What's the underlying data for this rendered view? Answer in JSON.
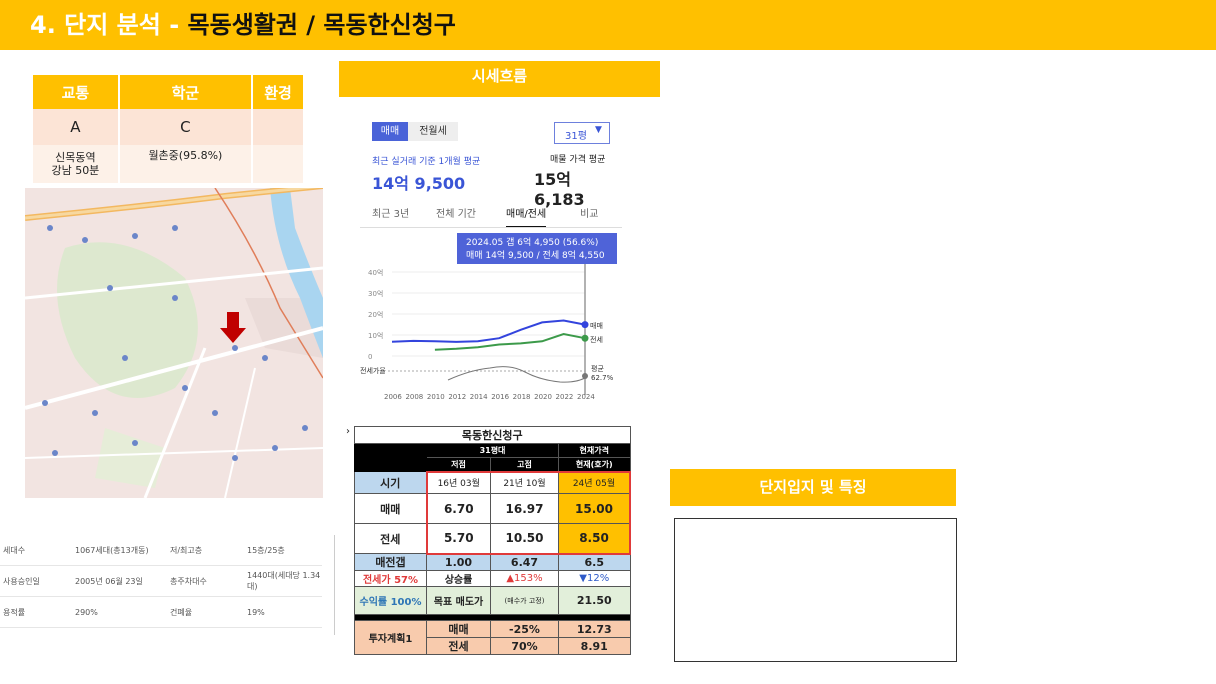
{
  "header": {
    "prefix": "4. 단지 분석 - ",
    "title": "목동생활권 / 목동한신청구"
  },
  "score": {
    "headers": [
      "교통",
      "학군",
      "환경"
    ],
    "grades": [
      "A",
      "C",
      ""
    ],
    "notes": [
      "신목동역\n강남 50분",
      "월촌중(95.8%)",
      ""
    ]
  },
  "info": {
    "rows": [
      [
        "세대수",
        "1067세대(총13개동)",
        "저/최고층",
        "15층/25층"
      ],
      [
        "사용승인일",
        "2005년 06월 23일",
        "총주차대수",
        "1440대(세대당 1.34대)"
      ],
      [
        "용적률",
        "290%",
        "건폐율",
        "19%"
      ]
    ]
  },
  "sise_title": "시세흐름",
  "price": {
    "tab_sale": "매매",
    "tab_rent": "전월세",
    "size": "31평",
    "recent_label": "최근 실거래 기준 1개월 평균",
    "recent_value": "14억 9,500",
    "ask_label": "매물 가격 평균",
    "ask_value": "15억 6,183",
    "periods": [
      "최근 3년",
      "전체 기간",
      "매매/전세",
      "비교"
    ],
    "tooltip1": "2024.05  갭 6억 4,950 (56.6%)",
    "tooltip2": "매매 14억 9,500 / 전세 8억 4,550",
    "ylabels": [
      "40억",
      "30억",
      "20억",
      "10억",
      "0"
    ],
    "ratio_label": "전세가율",
    "legend_sale": "매매",
    "legend_rent": "전세",
    "legend_avg": "평균",
    "legend_avg_val": "62.7%",
    "years": [
      "2006",
      "2008",
      "2010",
      "2012",
      "2014",
      "2016",
      "2018",
      "2020",
      "2022",
      "2024"
    ]
  },
  "chart_data": {
    "type": "line",
    "x": [
      2006,
      2008,
      2010,
      2012,
      2014,
      2016,
      2018,
      2020,
      2022,
      2024
    ],
    "series": [
      {
        "name": "매매",
        "values": [
          6.8,
          7.2,
          7.0,
          6.7,
          7.0,
          8.5,
          12.5,
          16.0,
          16.9,
          14.95
        ]
      },
      {
        "name": "전세",
        "values": [
          null,
          null,
          3.0,
          3.5,
          4.2,
          5.5,
          6.0,
          7.0,
          10.5,
          8.46
        ]
      }
    ],
    "ylim": [
      0,
      40
    ]
  },
  "table": {
    "title": "목동한신청구",
    "sub1": "31평대",
    "sub2": "현재가격",
    "cols": [
      "저점",
      "고점",
      "현재(호가)"
    ],
    "r_time": [
      "시기",
      "16년 03월",
      "21년 10월",
      "24년 05월"
    ],
    "r_sale": [
      "매매",
      "6.70",
      "16.97",
      "15.00"
    ],
    "r_rent": [
      "전세",
      "5.70",
      "10.50",
      "8.50"
    ],
    "r_gap": [
      "매전갭",
      "1.00",
      "6.47",
      "6.5"
    ],
    "r_ratio": [
      "전세가 57%",
      "상승률",
      "▲153%",
      "▼12%"
    ],
    "r_target": [
      "수익률 100%",
      "목표 매도가",
      "(매수가 고정)",
      "21.50"
    ],
    "r_plan_label": "투자계획1",
    "r_plan1": [
      "매매",
      "-25%",
      "12.73"
    ],
    "r_plan2": [
      "전세",
      "70%",
      "8.91"
    ]
  },
  "danji_title": "단지입지 및 특징"
}
